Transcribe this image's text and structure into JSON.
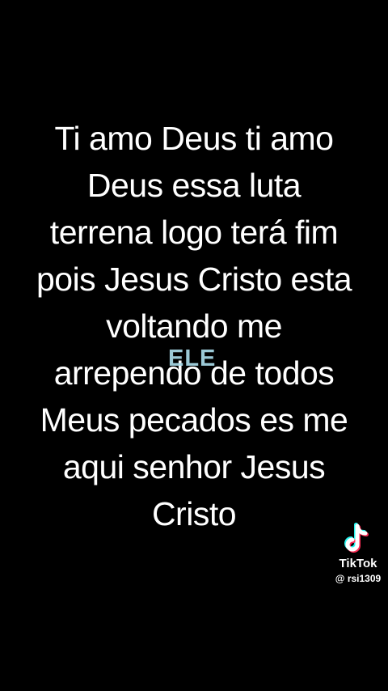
{
  "caption": {
    "lines": [
      "Ti amo Deus ti amo",
      "Deus essa luta",
      "terrena logo terá fim",
      "pois Jesus Cristo esta",
      "voltando me",
      "arrependo de todos",
      "Meus pecados es me",
      "aqui senhor Jesus",
      "Cristo"
    ],
    "text_color": "#ffffff"
  },
  "overlay_word": {
    "text": "ELE",
    "color": "#a9dbe9"
  },
  "watermark": {
    "icon": "tiktok-logo-icon",
    "brand": "TikTok",
    "username": "@ rsi1309"
  },
  "colors": {
    "background": "#000000",
    "tiktok_cyan": "#25f4ee",
    "tiktok_red": "#fe2c55"
  }
}
